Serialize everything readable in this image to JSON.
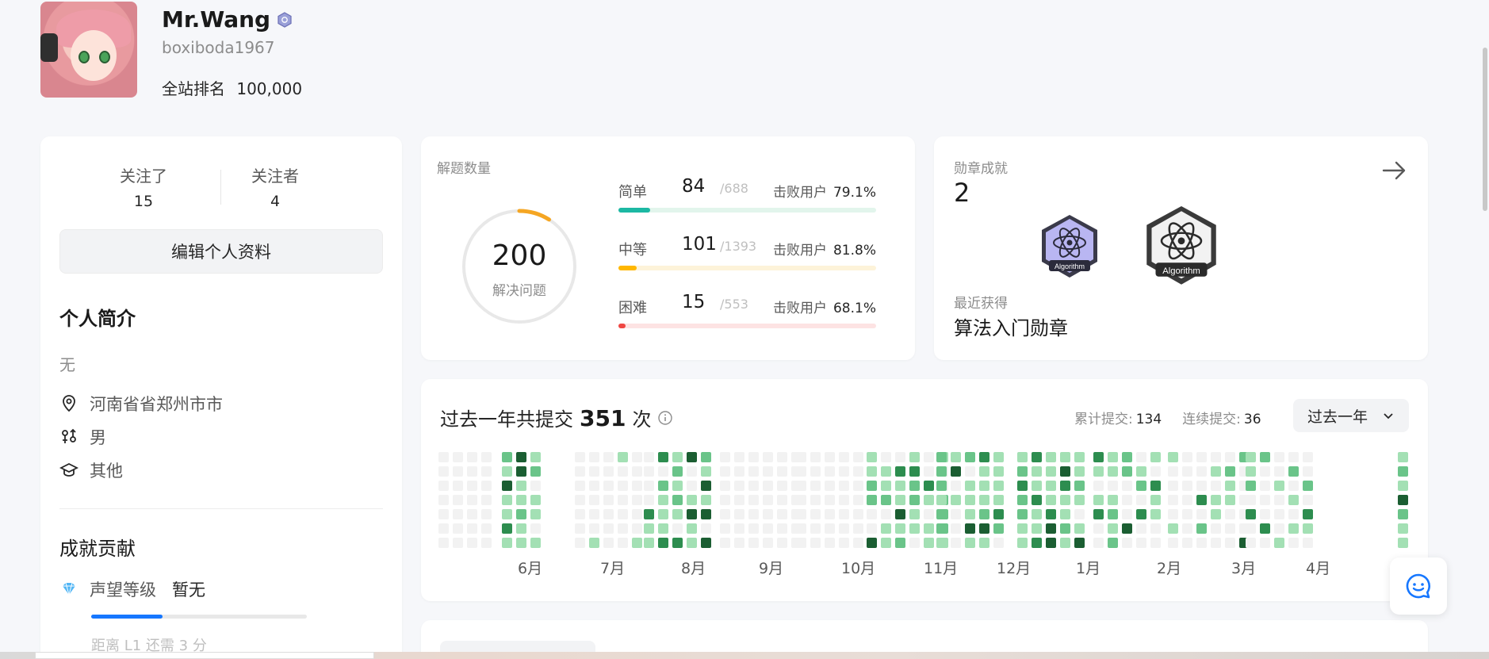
{
  "profile": {
    "name": "Mr.Wang",
    "handle": "boxiboda1967",
    "rank_label": "全站排名",
    "rank_value": "100,000"
  },
  "follow": {
    "following_label": "关注了",
    "following_count": "15",
    "followers_label": "关注者",
    "followers_count": "4"
  },
  "edit_profile_label": "编辑个人资料",
  "bio": {
    "title": "个人简介",
    "text": "无",
    "location": "河南省省郑州市市",
    "gender": "男",
    "school": "其他"
  },
  "contribution": {
    "title": "成就贡献",
    "reputation_label": "声望等级",
    "reputation_value": "暂无",
    "progress": 0.33,
    "hint": "距离 L1 还需 3 分"
  },
  "solved": {
    "label": "解题数量",
    "total": "200",
    "total_label": "解决问题",
    "ring_fraction": 0.09,
    "difficulties": [
      {
        "name": "简单",
        "solved": "84",
        "total": "/688",
        "beat_label": "击败用户",
        "beat": "79.1%",
        "fraction": 0.122,
        "color": "#1cb8a3",
        "track": "#e2f5ec"
      },
      {
        "name": "中等",
        "solved": "101",
        "total": "/1393",
        "beat_label": "击败用户",
        "beat": "81.8%",
        "fraction": 0.072,
        "color": "#ffb700",
        "track": "#fdf3d9"
      },
      {
        "name": "困难",
        "solved": "15",
        "total": "/553",
        "beat_label": "击败用户",
        "beat": "68.1%",
        "fraction": 0.027,
        "color": "#ef4743",
        "track": "#fde3e3"
      }
    ]
  },
  "badges": {
    "label": "勋章成就",
    "count": "2",
    "recent_label": "最近获得",
    "recent_name": "算法入门勋章",
    "badge_text": "Algorithm"
  },
  "calendar": {
    "title_prefix": "过去一年共提交",
    "count": "351",
    "title_suffix": "次",
    "total_label": "累计提交:",
    "total_value": "134",
    "streak_label": "连续提交:",
    "streak_value": "36",
    "range": "过去一年",
    "months": [
      "6月",
      "7月",
      "8月",
      "9月",
      "10月",
      "11月",
      "12月",
      "1月",
      "2月",
      "3月",
      "4月"
    ],
    "colors": {
      "empty": "#f2f2f2",
      "l1": "#a3e0b4",
      "l2": "#6ac489",
      "l3": "#2d8d4f",
      "l4": "#1b5e32"
    }
  }
}
